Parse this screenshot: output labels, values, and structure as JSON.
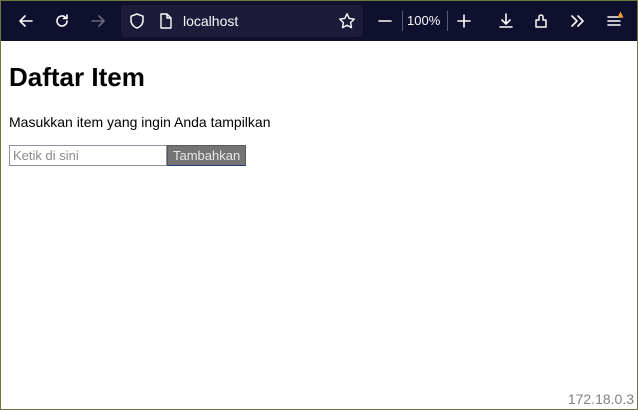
{
  "browser": {
    "url": "localhost",
    "zoom": "100%",
    "icons": [
      "back-icon",
      "reload-icon",
      "forward-icon",
      "shield-icon",
      "page-icon",
      "star-icon",
      "zoom-out-icon",
      "zoom-in-icon",
      "download-icon",
      "extensions-icon",
      "overflow-icon",
      "menu-icon"
    ]
  },
  "page": {
    "title": "Daftar Item",
    "description": "Masukkan item yang ingin Anda tampilkan",
    "input_placeholder": "Ketik di sini",
    "add_button": "Tambahkan"
  },
  "overlay": {
    "ip": "172.18.0.3"
  },
  "colors": {
    "toolbar_bg": "#0f0f2e",
    "urlbar_bg": "#1c1b3a",
    "button_bg": "#747474",
    "notification": "#f0a030"
  }
}
